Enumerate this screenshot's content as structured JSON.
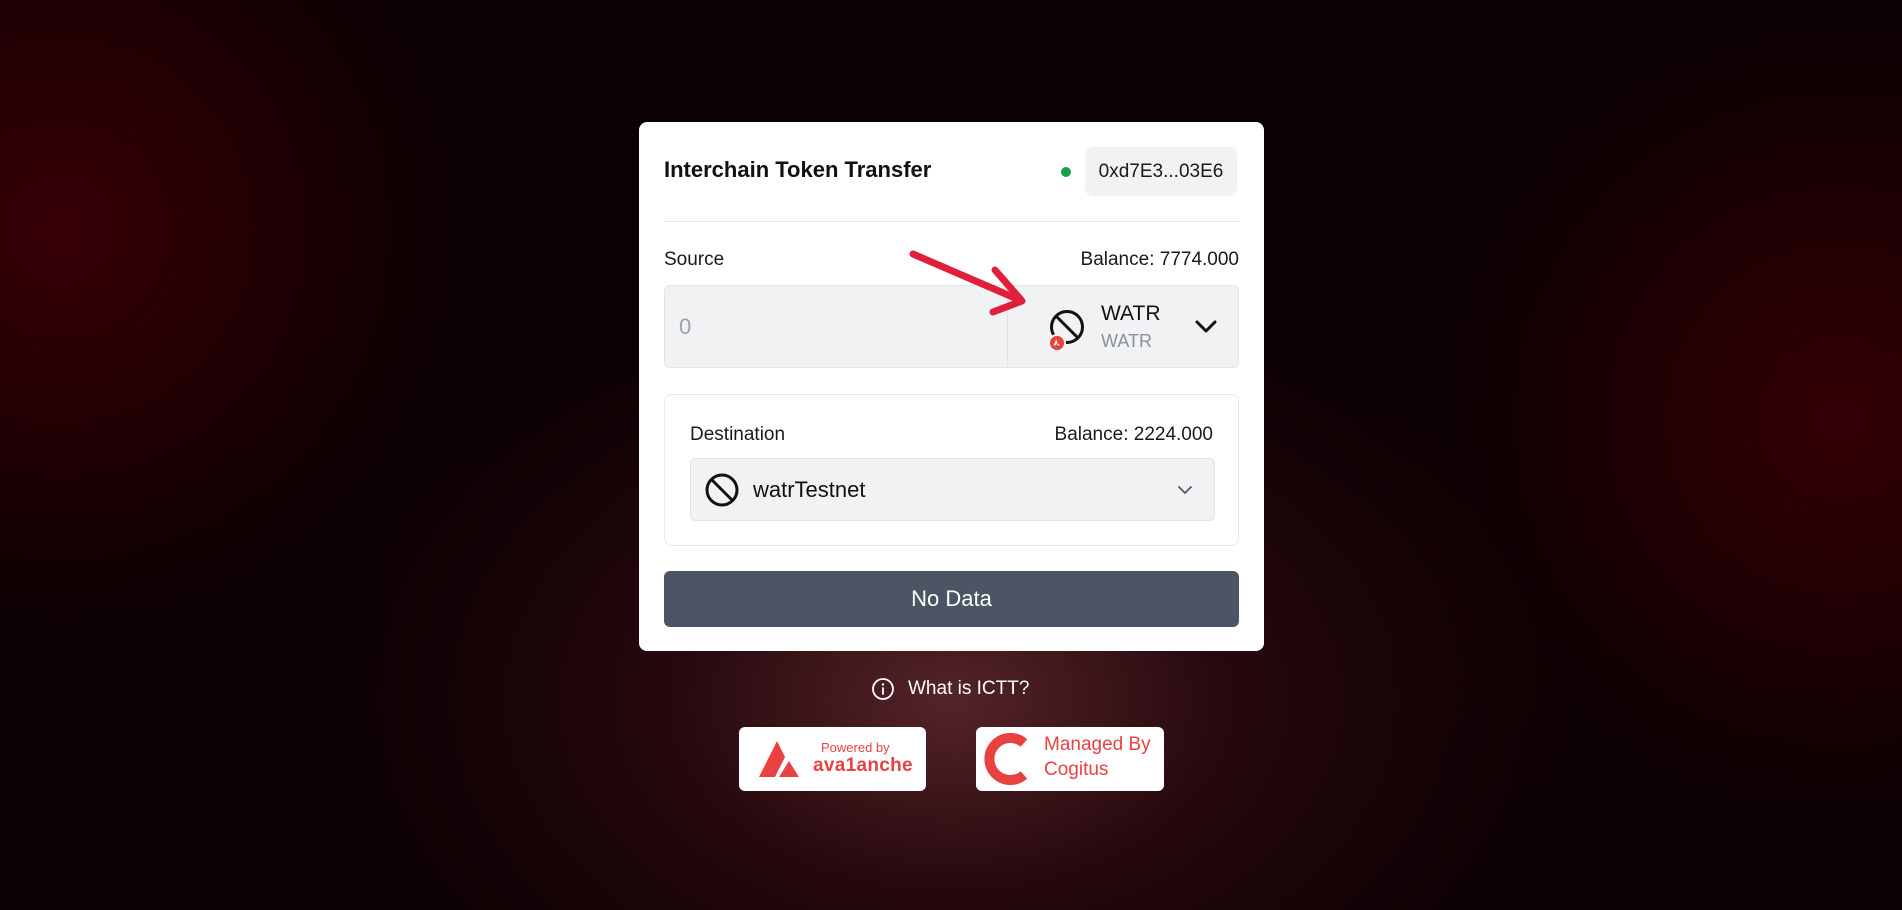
{
  "card": {
    "title": "Interchain Token Transfer",
    "wallet_address": "0xd7E3...03E6",
    "wallet_status_color": "#16a34a"
  },
  "source": {
    "label": "Source",
    "balance": "Balance: 7774.000",
    "amount_placeholder": "0",
    "token": {
      "name": "WATR",
      "symbol": "WATR",
      "icon": "prohibited-circle-icon",
      "chain_badge_icon": "avalanche-badge-icon"
    }
  },
  "destination": {
    "label": "Destination",
    "balance": "Balance: 2224.000",
    "chain": {
      "name": "watrTestnet",
      "icon": "prohibited-circle-icon"
    }
  },
  "submit": {
    "label": "No Data"
  },
  "help": {
    "label": "What is ICTT?",
    "icon": "info-icon"
  },
  "footer": {
    "powered_by": {
      "small": "Powered by",
      "big": "ava1anche"
    },
    "managed_by": {
      "line1": "Managed By",
      "line2": "Cogitus"
    }
  },
  "colors": {
    "brand_red": "#e84142",
    "button_gray": "#4b5563",
    "annotation_arrow": "#e0203a"
  }
}
